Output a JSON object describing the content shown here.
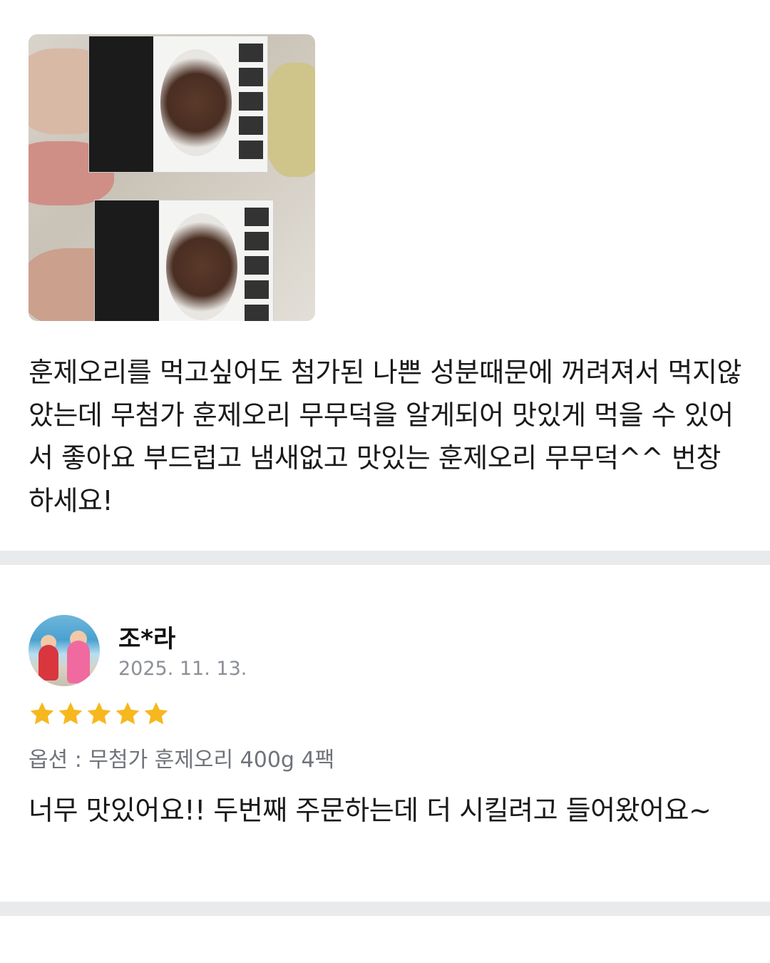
{
  "review1": {
    "photo_alt": "무무덕",
    "text": "훈제오리를 먹고싶어도 첨가된 나쁜 성분때문에 꺼려져서 먹지않았는데 무첨가 훈제오리 무무덕을 알게되어 맛있게 먹을 수 있어서 좋아요 부드럽고 냄새없고 맛있는 훈제오리 무무덕^^ 번창하세요!"
  },
  "review2": {
    "author": "조*라",
    "date": "2025. 11. 13.",
    "rating": 5,
    "option": "옵션 : 무첨가 훈제오리 400g 4팩",
    "text": "너무 맛있어요!! 두번째 주문하는데 더 시킬려고 들어왔어요~"
  },
  "colors": {
    "star": "#f7b81e",
    "divider": "#e9eaec",
    "meta_text": "#8b8f96"
  }
}
